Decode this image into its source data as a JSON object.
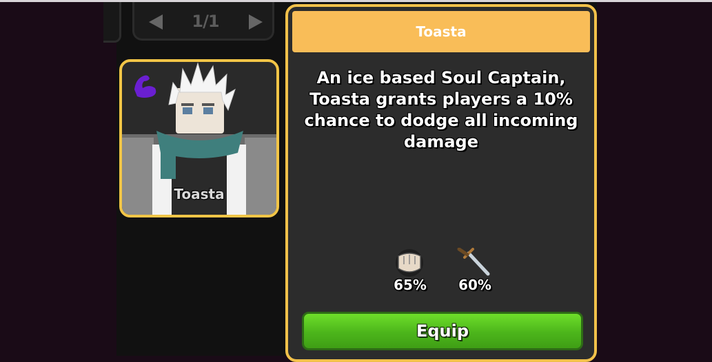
{
  "pager": {
    "label": "1/1"
  },
  "character": {
    "name": "Toasta",
    "badge_icon": "flexed-arm-icon"
  },
  "info": {
    "title": "Toasta",
    "description": "An ice based Soul Captain, Toasta grants players a 10% chance to dodge all incoming damage",
    "stats": [
      {
        "icon": "fist-icon",
        "value": "65%"
      },
      {
        "icon": "dagger-icon",
        "value": "60%"
      }
    ],
    "equip_label": "Equip"
  },
  "colors": {
    "background": "#1a0b17",
    "panel": "#2c2c2c",
    "accent_gold": "#f2c14a",
    "header": "#f9bd58",
    "equip_green": "#4cb51b",
    "badge_purple": "#6a1fd1"
  }
}
